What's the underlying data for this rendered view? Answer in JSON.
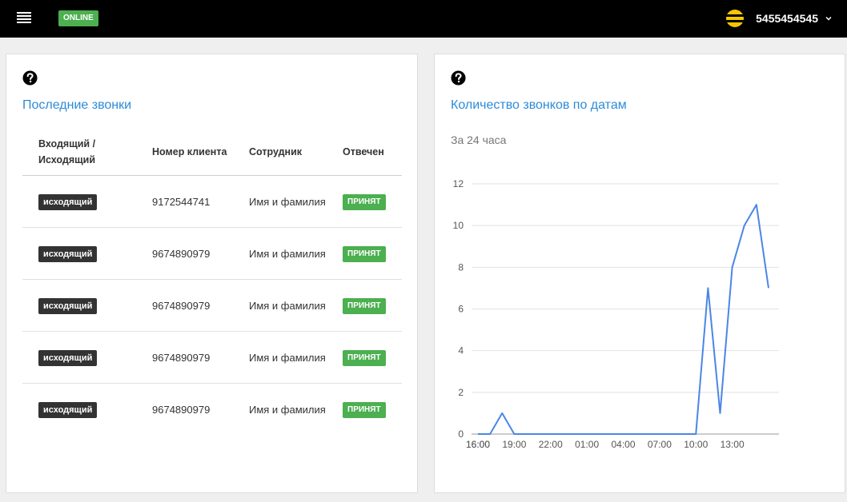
{
  "header": {
    "status_label": "ONLINE",
    "user_phone": "5455454545"
  },
  "recent_calls": {
    "title": "Последние звонки",
    "columns": [
      "Входящий / Исходящий",
      "Номер клиента",
      "Сотрудник",
      "Отвечен"
    ],
    "rows": [
      {
        "direction": "исходящий",
        "client": "9172544741",
        "employee": "Имя и фамилия",
        "status": "ПРИНЯТ"
      },
      {
        "direction": "исходящий",
        "client": "9674890979",
        "employee": "Имя и фамилия",
        "status": "ПРИНЯТ"
      },
      {
        "direction": "исходящий",
        "client": "9674890979",
        "employee": "Имя и фамилия",
        "status": "ПРИНЯТ"
      },
      {
        "direction": "исходящий",
        "client": "9674890979",
        "employee": "Имя и фамилия",
        "status": "ПРИНЯТ"
      },
      {
        "direction": "исходящий",
        "client": "9674890979",
        "employee": "Имя и фамилия",
        "status": "ПРИНЯТ"
      }
    ]
  },
  "calls_by_date": {
    "title": "Количество звонков по датам",
    "subtitle": "За 24 часа"
  },
  "chart_data": {
    "type": "line",
    "title": "Количество звонков по датам",
    "subtitle": "За 24 часа",
    "xlabel": "",
    "ylabel": "",
    "x": [
      "16:00",
      "17:00",
      "18:00",
      "19:00",
      "20:00",
      "21:00",
      "22:00",
      "23:00",
      "00:00",
      "01:00",
      "02:00",
      "03:00",
      "04:00",
      "05:00",
      "06:00",
      "07:00",
      "08:00",
      "09:00",
      "10:00",
      "11:00",
      "12:00",
      "13:00",
      "14:00",
      "15:00",
      "16:00"
    ],
    "x_tick_labels": [
      "16:00",
      "19:00",
      "22:00",
      "01:00",
      "04:00",
      "07:00",
      "10:00",
      "13:00",
      "16:00"
    ],
    "series": [
      {
        "values": [
          0,
          0,
          1,
          0,
          0,
          0,
          0,
          0,
          0,
          0,
          0,
          0,
          0,
          0,
          0,
          0,
          0,
          0,
          0,
          7,
          1,
          8,
          10,
          11,
          7
        ],
        "color": "#4a86e8"
      }
    ],
    "y_ticks": [
      0,
      2,
      4,
      6,
      8,
      10,
      12
    ],
    "ylim": [
      0,
      12
    ],
    "grid": true,
    "legend": "none"
  },
  "colors": {
    "accent": "#2d8ad8",
    "line": "#4a86e8",
    "online": "#4caf50",
    "accepted": "#4caf50",
    "direction_badge": "#333333"
  },
  "icons": {
    "menu": "menu-icon",
    "help": "help-icon",
    "user_logo": "beeline-logo-icon",
    "dropdown": "chevron-down-icon"
  }
}
